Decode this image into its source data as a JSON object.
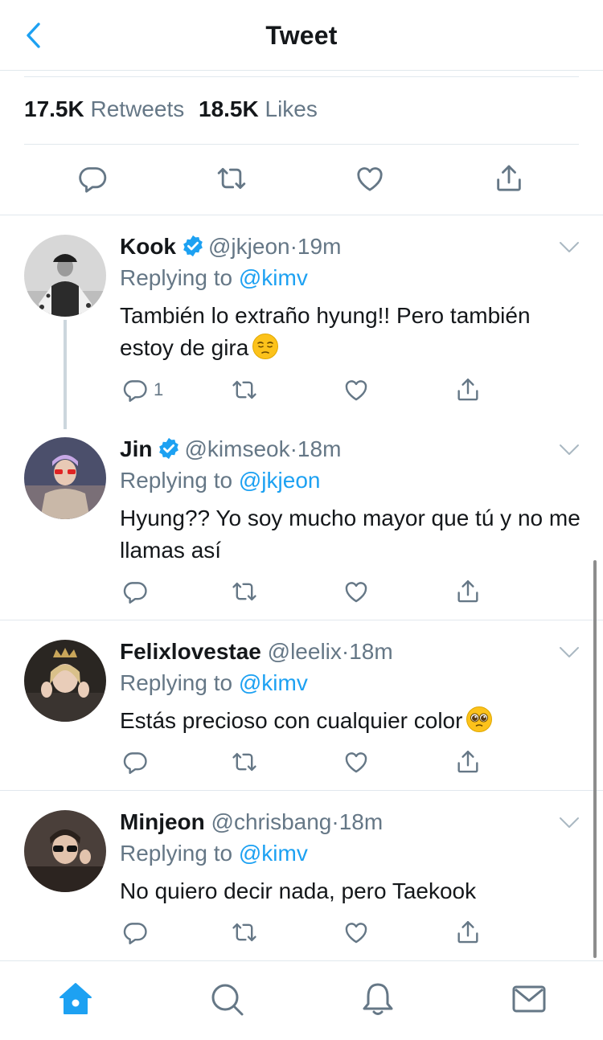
{
  "header": {
    "title": "Tweet",
    "back_icon": "chevron-left-icon"
  },
  "stats": {
    "retweets_count": "17.5K",
    "retweets_label": "Retweets",
    "likes_count": "18.5K",
    "likes_label": "Likes"
  },
  "colors": {
    "accent": "#1da1f2",
    "muted": "#657786",
    "text": "#14171a",
    "divider": "#e1e8ed"
  },
  "replies": [
    {
      "name": "Kook",
      "verified": true,
      "handle": "@jkjeon",
      "dot": "·",
      "time": "19m",
      "replying_label": "Replying to",
      "mention": "@kimv",
      "text": "También lo extraño hyung!! Pero también estoy de gira",
      "emoji": "pensive-face",
      "reply_count": "1"
    },
    {
      "name": "Jin",
      "verified": true,
      "handle": "@kimseok",
      "dot": "·",
      "time": "18m",
      "replying_label": "Replying to",
      "mention": "@jkjeon",
      "text": "Hyung?? Yo soy mucho mayor que tú y no me llamas así",
      "reply_count": ""
    },
    {
      "name": "Felixlovestae",
      "verified": false,
      "handle": "@leelix",
      "dot": "·",
      "time": "18m",
      "replying_label": "Replying to",
      "mention": "@kimv",
      "text": "Estás precioso con cualquier color",
      "emoji": "pleading-face",
      "reply_count": ""
    },
    {
      "name": "Minjeon",
      "verified": false,
      "handle": "@chrisbang",
      "dot": "·",
      "time": "18m",
      "replying_label": "Replying to",
      "mention": "@kimv",
      "text": "No quiero decir nada, pero Taekook",
      "reply_count": ""
    }
  ],
  "tabbar": {
    "items": [
      "home-icon",
      "search-icon",
      "notifications-icon",
      "messages-icon"
    ],
    "active": "home-icon"
  }
}
